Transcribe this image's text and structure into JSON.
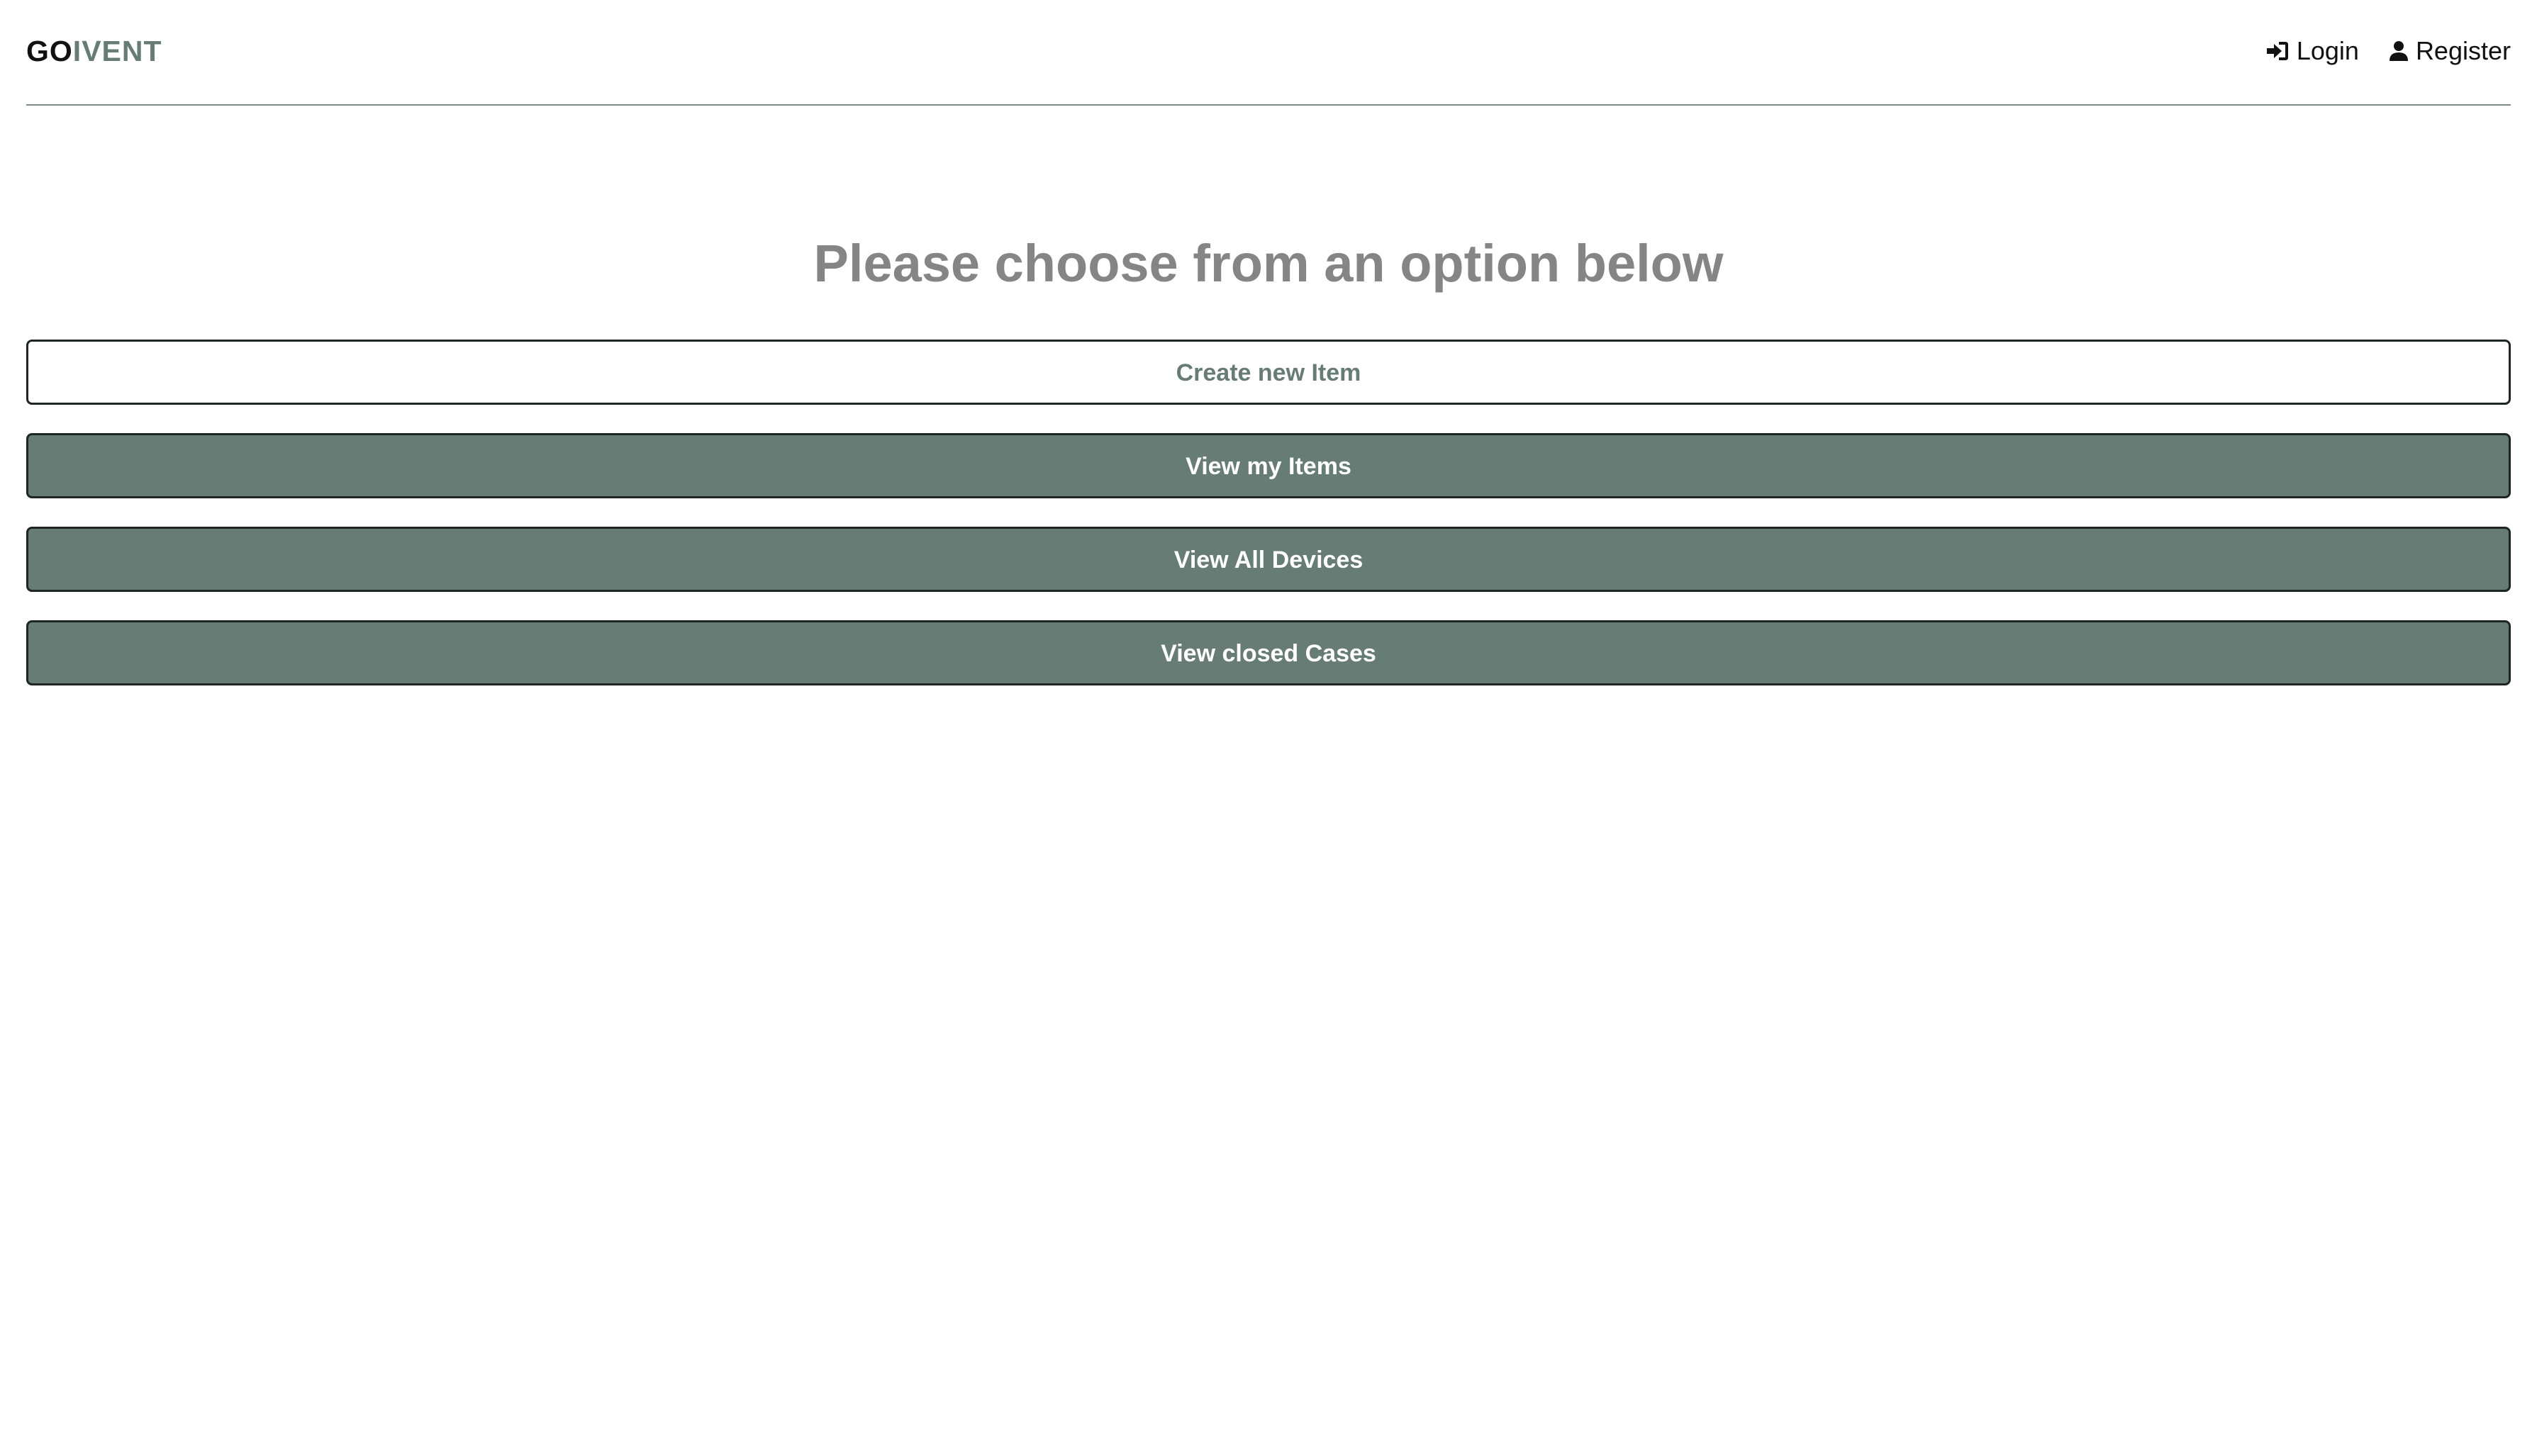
{
  "brand": {
    "part1": "GO",
    "part2": "IVENT"
  },
  "nav": {
    "login_label": "Login",
    "login_icon": "sign-in-icon",
    "register_label": "Register",
    "register_icon": "user-icon"
  },
  "main": {
    "heading": "Please choose from an option below",
    "options": [
      {
        "label": "Create new Item",
        "style": "outline"
      },
      {
        "label": "View my Items",
        "style": "filled"
      },
      {
        "label": "View All Devices",
        "style": "filled"
      },
      {
        "label": "View closed Cases",
        "style": "filled"
      }
    ]
  },
  "colors": {
    "accent": "#667c74",
    "heading": "#858585",
    "text": "#111111",
    "border": "#1d2624"
  }
}
